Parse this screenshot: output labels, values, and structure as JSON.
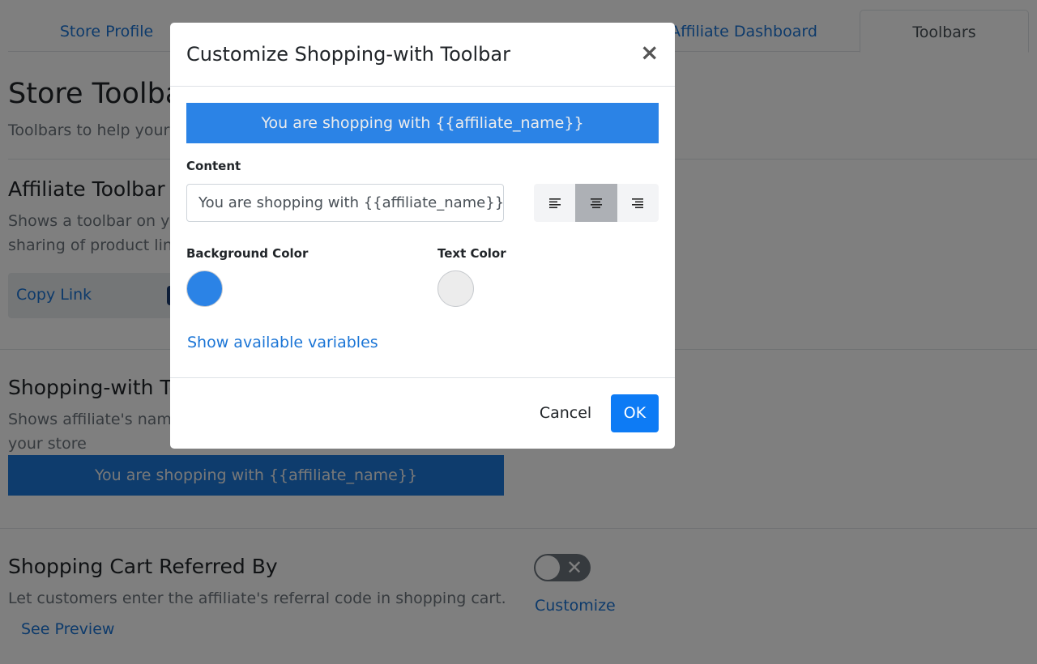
{
  "tabs": {
    "store_profile": "Store Profile",
    "affiliate_dashboard": "Affiliate Dashboard",
    "toolbars": "Toolbars"
  },
  "page": {
    "title": "Store Toolbars",
    "subtitle": "Toolbars to help your c"
  },
  "affiliate_toolbar": {
    "title": "Affiliate Toolbar",
    "desc_line1": "Shows a toolbar on you",
    "desc_line2": "sharing of product link",
    "copy_link": "Copy Link"
  },
  "shopping_with": {
    "title": "Shopping-with Toolbar",
    "desc_line1": "Shows affiliate's name",
    "desc_line2": "your store",
    "preview_text": "You are shopping with {{affiliate_name}}",
    "preview_bg": "#1c79da"
  },
  "cart_referred": {
    "title": "Shopping Cart Referred By",
    "desc": "Let customers enter the affiliate's referral code in shopping cart.",
    "see_preview": "See Preview",
    "customize": "Customize",
    "toggle_on": false
  },
  "modal": {
    "title": "Customize Shopping-with Toolbar",
    "close_icon": "close-icon",
    "preview_text": "You are shopping with {{affiliate_name}}",
    "content_label": "Content",
    "content_value": "You are shopping with {{affiliate_name}}",
    "alignment": {
      "options": [
        "align-left",
        "align-center",
        "align-right"
      ],
      "selected": "align-center"
    },
    "background_color_label": "Background Color",
    "background_color": "#2b83e6",
    "text_color_label": "Text Color",
    "text_color": "#ececec",
    "show_variables": "Show available variables",
    "cancel": "Cancel",
    "ok": "OK"
  }
}
